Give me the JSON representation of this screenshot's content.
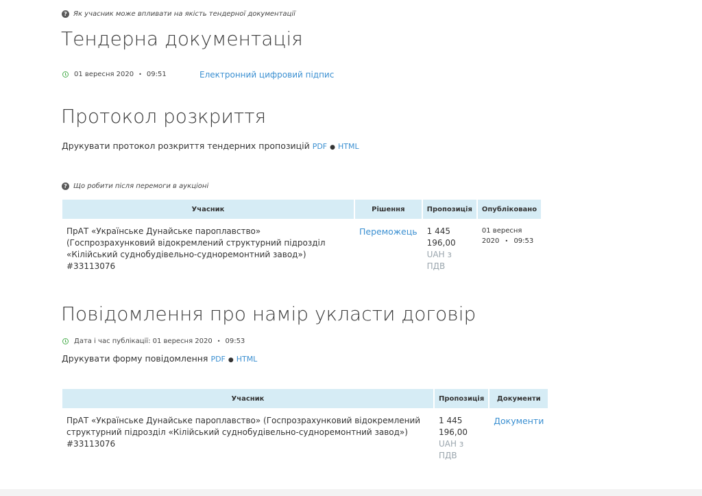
{
  "help": {
    "tender_docs_hint": "Як учасник може впливати на якість тендерної документації",
    "after_win_hint": "Що робити після перемоги в аукціоні"
  },
  "tender_docs": {
    "title": "Тендерна документація",
    "date": "01 вересня 2020",
    "time": "09:51",
    "signature_link": "Електронний цифровий підпис"
  },
  "opening_protocol": {
    "title": "Протокол розкриття",
    "print_text": "Друкувати протокол розкриття тендерних пропозицій",
    "pdf": "PDF",
    "sep": "●",
    "html": "HTML"
  },
  "results_table": {
    "headers": [
      "Учасник",
      "Рішення",
      "Пропозиція",
      "Опубліковано"
    ],
    "row": {
      "participant": "ПрАТ «Українське Дунайське пароплавство» (Госпрозрахунковий відокремлений структурний підрозділ «Кілійський суднобудівельно-судноремонтний завод»)",
      "code": "#33113076",
      "decision": "Переможець",
      "amount": "1 445 196,00",
      "currency": "UAH з ПДВ",
      "pub_date": "01 вересня 2020",
      "pub_time": "09:53"
    }
  },
  "intent_notice": {
    "title": "Повідомлення про намір укласти договір",
    "pub_label": "Дата і час публікації: 01 вересня 2020",
    "pub_time": "09:53",
    "print_text": "Друкувати форму повідомлення",
    "pdf": "PDF",
    "sep": "●",
    "html": "HTML"
  },
  "intent_table": {
    "headers": [
      "Учасник",
      "Пропозиція",
      "Документи"
    ],
    "row": {
      "participant": "ПрАТ «Українське Дунайське пароплавство» (Госпрозрахунковий відокремлений структурний підрозділ «Кілійський суднобудівельно-судноремонтний завод»)",
      "code": "#33113076",
      "amount": "1 445 196,00",
      "currency": "UAH з ПДВ",
      "docs_link": "Документи"
    }
  }
}
